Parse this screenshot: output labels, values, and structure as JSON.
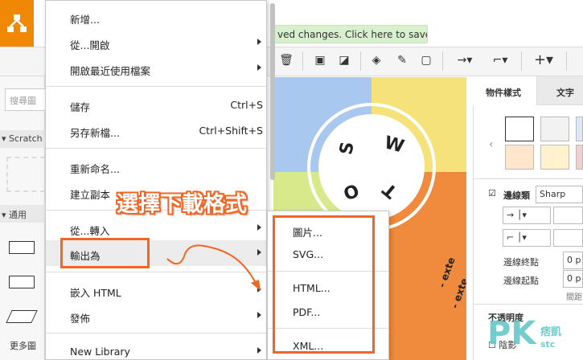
{
  "colors": {
    "brand_orange": "#f08705",
    "highlight": "#f26522",
    "save_banner_bg": "#d9f0cf"
  },
  "app": {
    "logo_icon": "drawio-logo-icon",
    "save_banner": "ved changes. Click here to save."
  },
  "left_panel": {
    "search_placeholder": "搜尋圖",
    "scratch_label": "Scratch",
    "general_label": "通用",
    "more_shapes": "更多圖"
  },
  "file_menu": {
    "items": [
      {
        "label": "新增...",
        "shortcut": "",
        "submenu": false
      },
      {
        "label": "從...開啟",
        "shortcut": "",
        "submenu": true
      },
      {
        "label": "開啟最近使用檔案",
        "shortcut": "",
        "submenu": true
      },
      {
        "label": "儲存",
        "shortcut": "Ctrl+S",
        "submenu": false
      },
      {
        "label": "另存新檔...",
        "shortcut": "Ctrl+Shift+S",
        "submenu": false
      },
      {
        "label": "重新命名...",
        "shortcut": "",
        "submenu": false
      },
      {
        "label": "建立副本",
        "shortcut": "",
        "submenu": false
      },
      {
        "label": "從...轉入",
        "shortcut": "",
        "submenu": true
      },
      {
        "label": "輸出為",
        "shortcut": "",
        "submenu": true
      },
      {
        "label": "嵌入 HTML",
        "shortcut": "",
        "submenu": true
      },
      {
        "label": "發佈",
        "shortcut": "",
        "submenu": true
      },
      {
        "label": "New Library",
        "shortcut": "",
        "submenu": true
      }
    ]
  },
  "export_submenu": {
    "items": [
      "圖片...",
      "SVG...",
      "HTML...",
      "PDF...",
      "XML..."
    ]
  },
  "annotation": {
    "callout": "選擇下載格式"
  },
  "canvas": {
    "swot_letters": [
      "S",
      "W",
      "O",
      "T"
    ],
    "external_label": "- exte"
  },
  "right_panel": {
    "tab_style": "物件樣式",
    "tab_text": "文字",
    "edge_style_label": "邊線類",
    "edge_style_value": "Sharp",
    "line_end_label": "邊線終點",
    "line_start_label": "邊線起點",
    "line_end_value": "0 p",
    "line_start_value": "0 p",
    "spacing_label": "間距",
    "opacity_label": "不透明度",
    "shadow_label": "陰影"
  },
  "watermark": {
    "text": "痞凱",
    "sub": "stc"
  }
}
